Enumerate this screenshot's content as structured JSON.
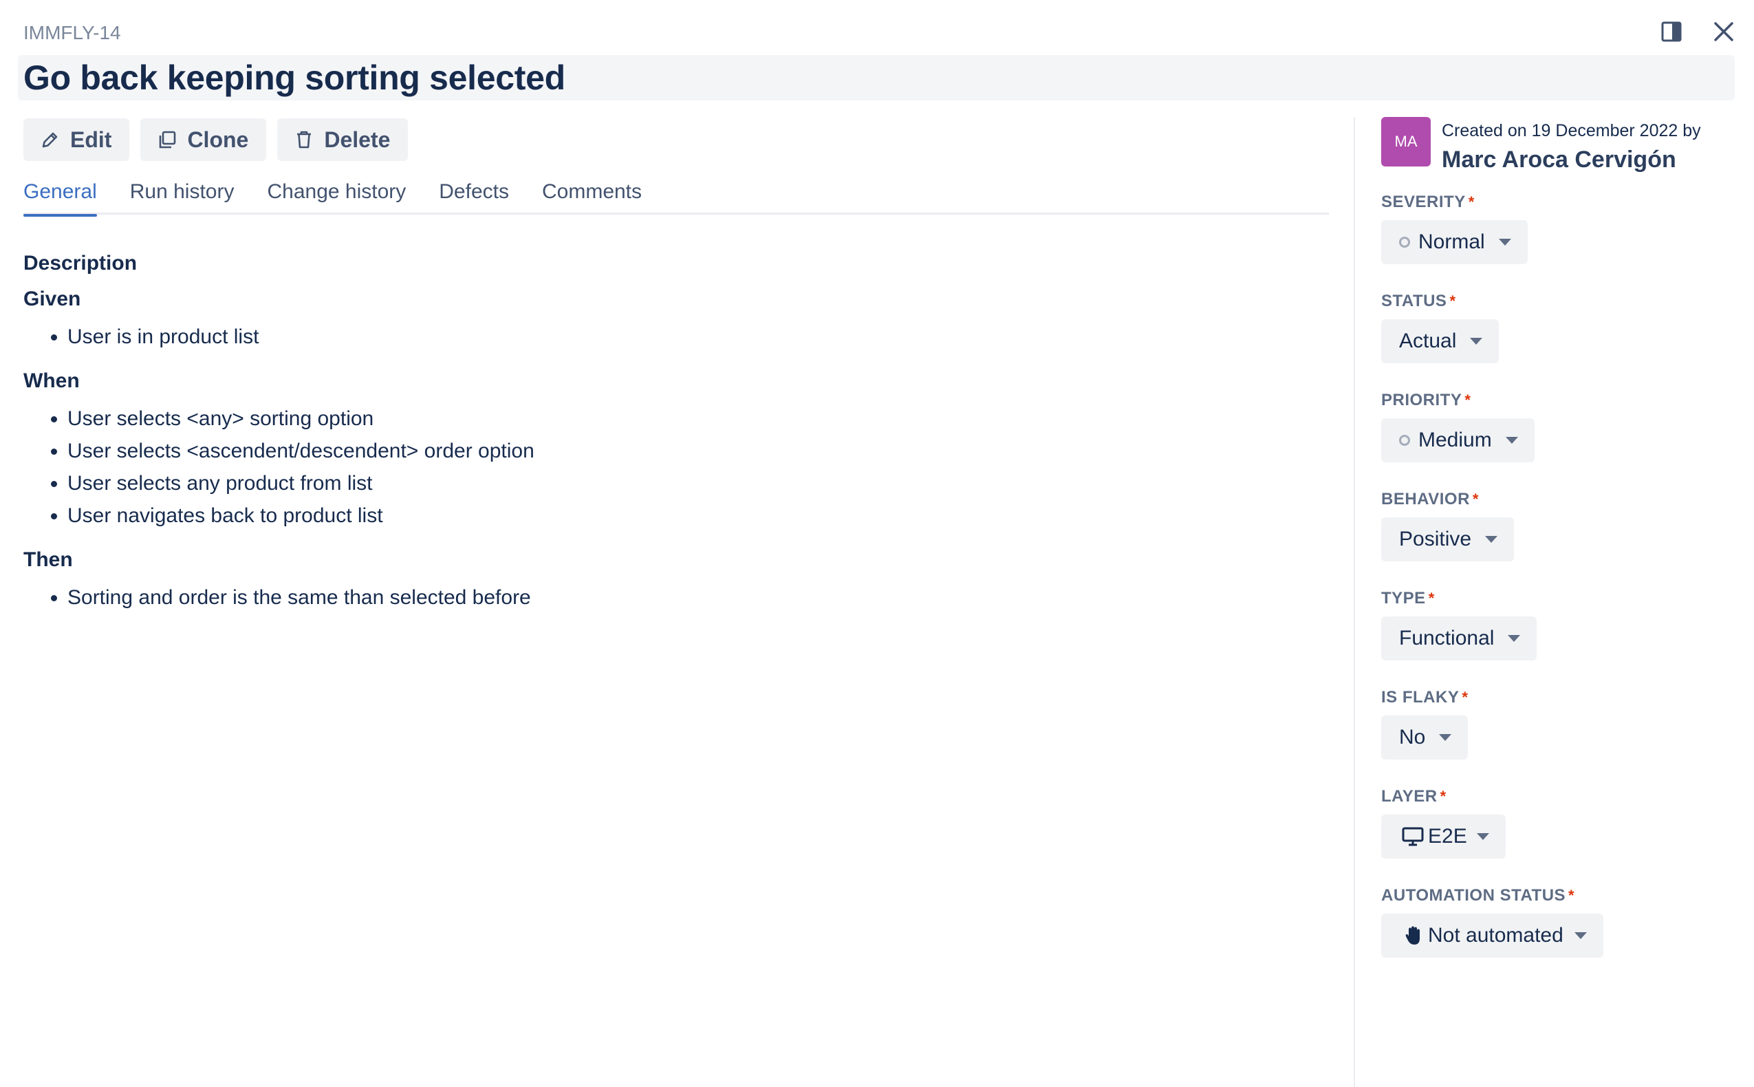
{
  "issue_key": "IMMFLY-14",
  "title": "Go back keeping sorting selected",
  "window_icons": {
    "panel": "sidebar-panel-icon",
    "close": "close-icon"
  },
  "actions": [
    {
      "label": "Edit",
      "icon": "pencil-icon"
    },
    {
      "label": "Clone",
      "icon": "copy-icon"
    },
    {
      "label": "Delete",
      "icon": "trash-icon"
    }
  ],
  "tabs": [
    {
      "label": "General",
      "active": true
    },
    {
      "label": "Run history",
      "active": false
    },
    {
      "label": "Change history",
      "active": false
    },
    {
      "label": "Defects",
      "active": false
    },
    {
      "label": "Comments",
      "active": false
    }
  ],
  "description": {
    "heading": "Description",
    "sections": [
      {
        "title": "Given",
        "items": [
          "User is in product list"
        ]
      },
      {
        "title": "When",
        "items": [
          "User selects <any> sorting option",
          "User selects <ascendent/descendent> order option",
          "User selects any product from list",
          "User navigates back to product list"
        ]
      },
      {
        "title": "Then",
        "items": [
          "Sorting and order is the same than selected before"
        ]
      }
    ]
  },
  "creator": {
    "initials": "MA",
    "avatar_color": "#b04cad",
    "created_text": "Created on 19 December 2022 by",
    "name": "Marc Aroca Cervigón"
  },
  "fields": [
    {
      "label": "SEVERITY",
      "required": "*",
      "value": "Normal",
      "icon": "circle-outline-icon"
    },
    {
      "label": "STATUS",
      "required": "*",
      "value": "Actual",
      "icon": ""
    },
    {
      "label": "PRIORITY",
      "required": "*",
      "value": "Medium",
      "icon": "circle-outline-icon"
    },
    {
      "label": "BEHAVIOR",
      "required": "*",
      "value": "Positive",
      "icon": ""
    },
    {
      "label": "TYPE",
      "required": "*",
      "value": "Functional",
      "icon": ""
    },
    {
      "label": "IS FLAKY",
      "required": "*",
      "value": "No",
      "icon": ""
    },
    {
      "label": "LAYER",
      "required": "*",
      "value": "E2E",
      "icon": "monitor-icon"
    },
    {
      "label": "AUTOMATION STATUS",
      "required": "*",
      "value": "Not automated",
      "icon": "hand-icon"
    }
  ],
  "colors": {
    "accent": "#3b6ec0",
    "required": "#de350b",
    "text": "#172b4d"
  }
}
